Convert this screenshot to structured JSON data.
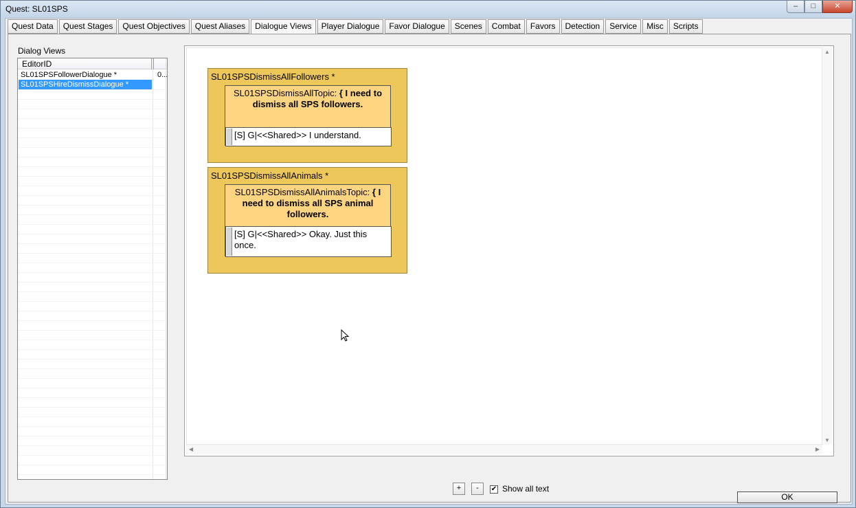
{
  "window": {
    "title": "Quest: SL01SPS",
    "minimize": "–",
    "maximize": "□",
    "close": "✕"
  },
  "tabs": [
    {
      "label": "Quest Data"
    },
    {
      "label": "Quest Stages"
    },
    {
      "label": "Quest Objectives"
    },
    {
      "label": "Quest Aliases"
    },
    {
      "label": "Dialogue Views",
      "active": true
    },
    {
      "label": "Player Dialogue"
    },
    {
      "label": "Favor Dialogue"
    },
    {
      "label": "Scenes"
    },
    {
      "label": "Combat"
    },
    {
      "label": "Favors"
    },
    {
      "label": "Detection"
    },
    {
      "label": "Service"
    },
    {
      "label": "Misc"
    },
    {
      "label": "Scripts"
    }
  ],
  "dialog_views": {
    "label": "Dialog Views",
    "column_header": "EditorID",
    "rows": [
      {
        "editor_id": "SL01SPSFollowerDialogue *",
        "col2": "0...",
        "selected": false
      },
      {
        "editor_id": "SL01SPSHireDismissDialogue *",
        "col2": "",
        "selected": true
      }
    ]
  },
  "canvas": {
    "groups": [
      {
        "title": "SL01SPSDismissAllFollowers *",
        "topic_name": "SL01SPSDismissAllTopic:",
        "topic_text": "{ I need to dismiss all SPS followers.",
        "response": "[S] G|<<Shared>> I understand."
      },
      {
        "title": "SL01SPSDismissAllAnimals *",
        "topic_name": "SL01SPSDismissAllAnimalsTopic:",
        "topic_text": "{ I need to dismiss all SPS animal followers.",
        "response": "[S] G|<<Shared>> Okay. Just this once."
      }
    ]
  },
  "controls": {
    "zoom_in": "+",
    "zoom_out": "-",
    "show_all_text_label": "Show all text",
    "show_all_text_checked": true,
    "check_mark": "✔",
    "ok_label": "OK"
  },
  "colors": {
    "group_fill": "#eec75b",
    "topic_fill": "#fdd581",
    "selection": "#3399ff"
  }
}
